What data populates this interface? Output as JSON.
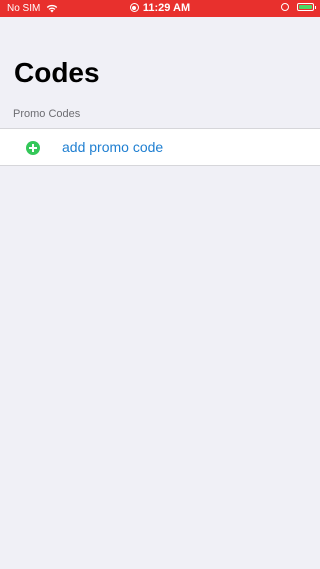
{
  "status_bar": {
    "carrier": "No SIM",
    "time": "11:29 AM",
    "icons": [
      "wifi-icon",
      "record-icon",
      "orientation-lock-icon",
      "battery-icon"
    ],
    "color": "#e8302d"
  },
  "page": {
    "title": "Codes"
  },
  "section": {
    "header": "Promo Codes",
    "items": [
      {
        "label": "add promo code",
        "icon": "add-icon",
        "icon_color": "#34c759",
        "text_color": "#1f7fd1"
      }
    ]
  }
}
